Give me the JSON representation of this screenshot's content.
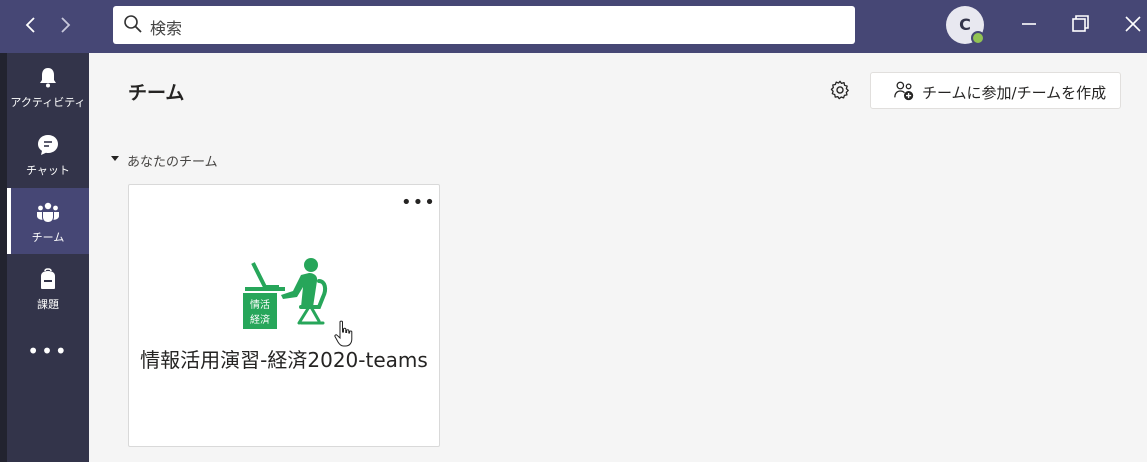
{
  "titlebar": {
    "search_placeholder": "検索",
    "avatar_initial": "C"
  },
  "rail": {
    "items": [
      {
        "label": "アクティビティ"
      },
      {
        "label": "チャット"
      },
      {
        "label": "チーム"
      },
      {
        "label": "課題"
      }
    ],
    "more_label": "•••"
  },
  "main": {
    "title": "チーム",
    "join_button": "チームに参加/チームを作成",
    "section_label": "あなたのチーム",
    "team_card": {
      "name": "情報活用演習-経済2020-teams",
      "logo_text_line1": "情活",
      "logo_text_line2": "経済",
      "more_label": "•••"
    }
  },
  "colors": {
    "titlebar": "#464775",
    "rail": "#33344a",
    "accent_green": "#27a65a",
    "presence": "#92c353"
  }
}
